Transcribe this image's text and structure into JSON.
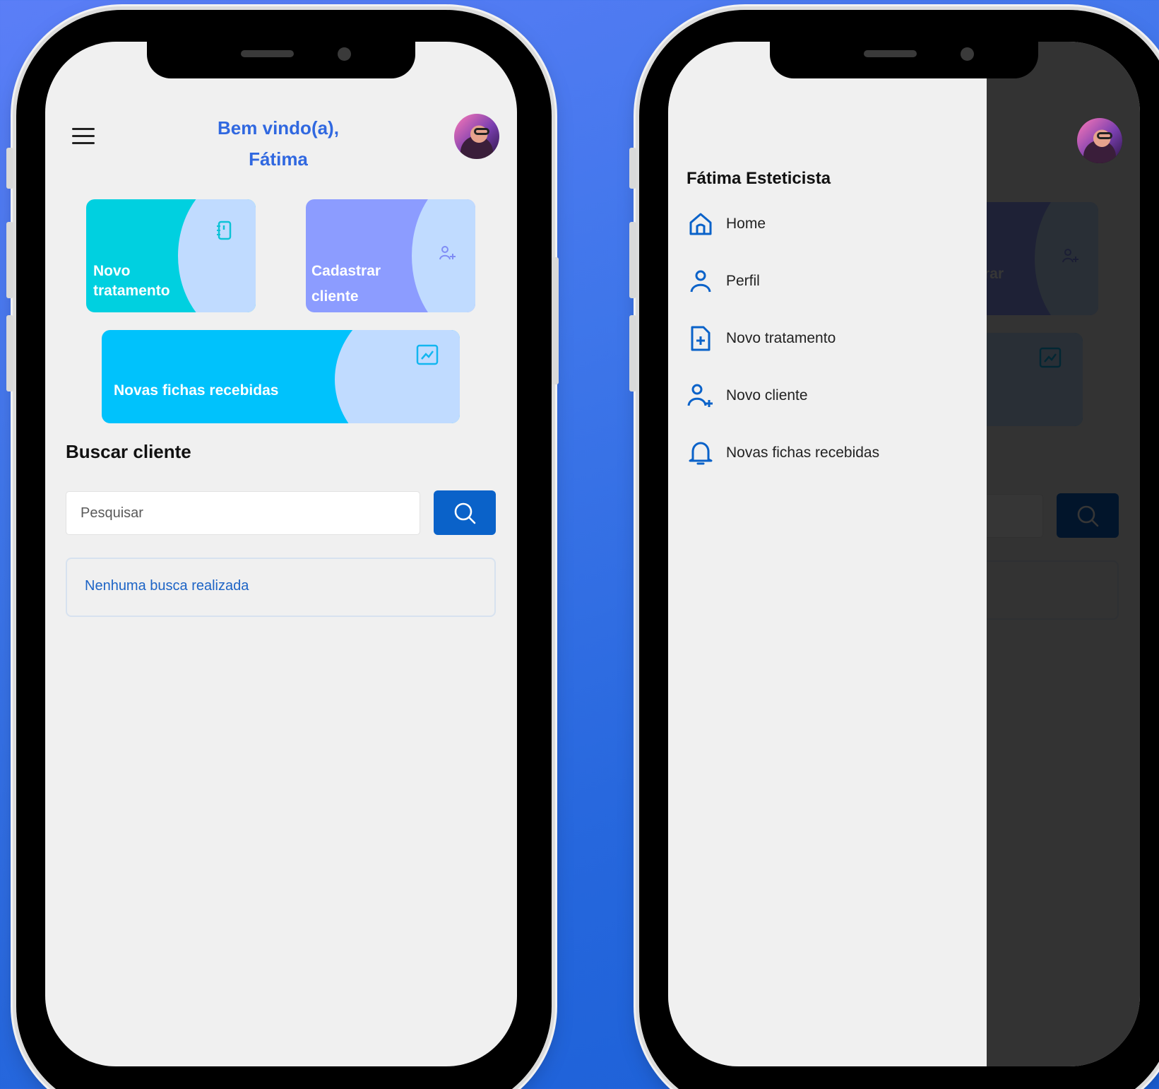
{
  "home": {
    "welcome_line1": "Bem vindo(a),",
    "welcome_line2": "Fátima",
    "cards": [
      {
        "line1": "Novo",
        "line2": "tratamento"
      },
      {
        "line1": "Cadastrar",
        "line2": "cliente"
      },
      {
        "line1": "Novas fichas recebidas"
      }
    ],
    "search": {
      "title": "Buscar cliente",
      "placeholder": "Pesquisar",
      "empty_result": "Nenhuma busca realizada"
    }
  },
  "drawer": {
    "user_name": "Fátima Esteticista",
    "items": [
      {
        "label": "Home",
        "icon": "home-icon"
      },
      {
        "label": "Perfil",
        "icon": "user-icon"
      },
      {
        "label": "Novo tratamento",
        "icon": "file-plus-icon"
      },
      {
        "label": "Novo cliente",
        "icon": "user-plus-icon"
      },
      {
        "label": "Novas fichas recebidas",
        "icon": "bell-icon"
      }
    ]
  },
  "colors": {
    "accent": "#0a62c9",
    "welcome": "#3068e0",
    "card_teal": "#00d0e0",
    "card_purple": "#8c9cff",
    "card_sky": "#00c2fc"
  }
}
